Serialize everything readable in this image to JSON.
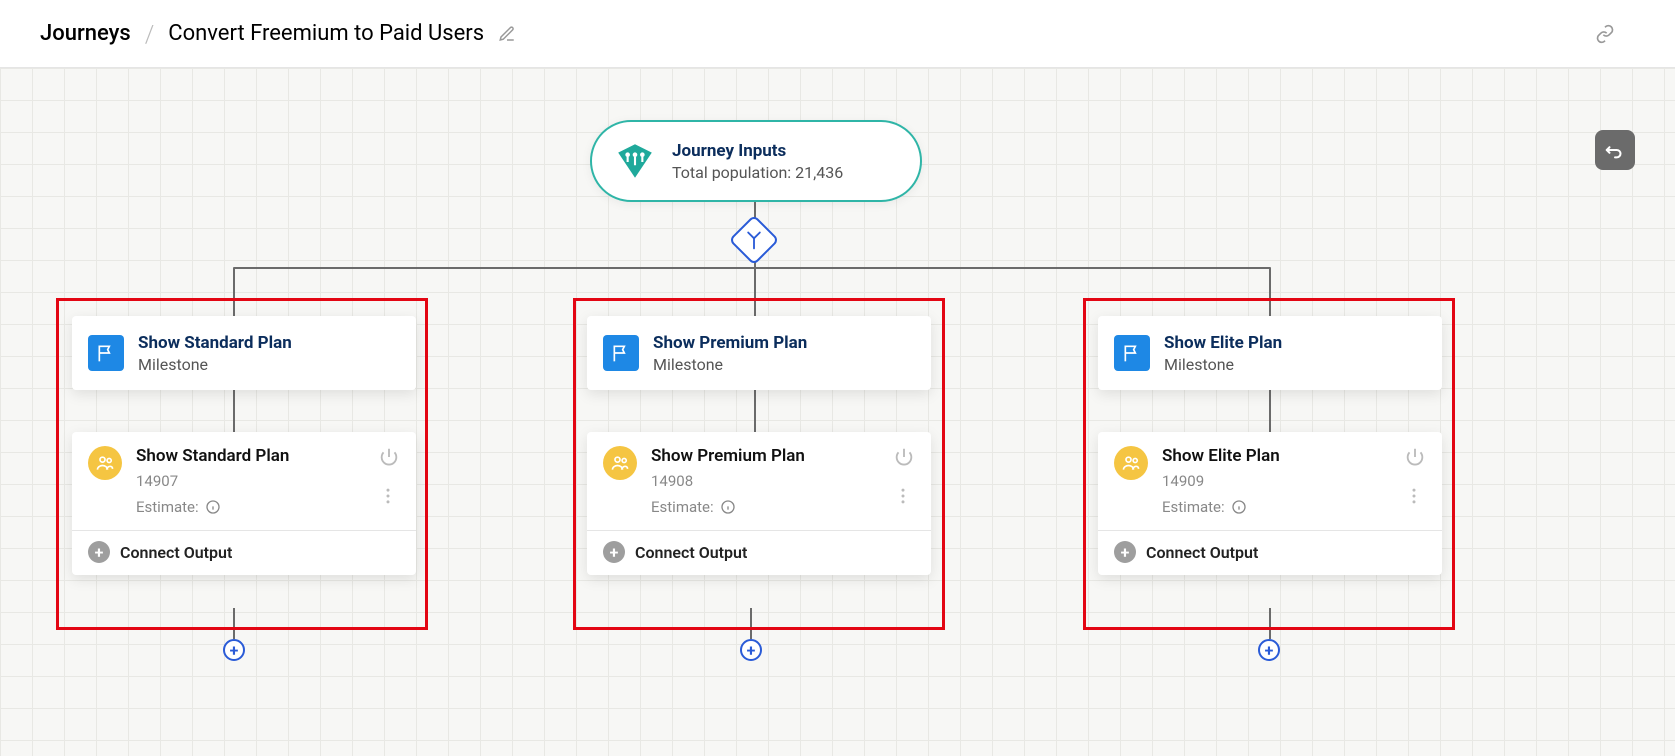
{
  "breadcrumb": {
    "root": "Journeys",
    "current": "Convert Freemium to Paid Users"
  },
  "journey_inputs": {
    "title": "Journey Inputs",
    "subtitle": "Total population: 21,436"
  },
  "milestone_label": "Milestone",
  "estimate_label": "Estimate:",
  "connect_output_label": "Connect Output",
  "branches": [
    {
      "milestone_title": "Show Standard Plan",
      "action_title": "Show Standard Plan",
      "action_id": "14907"
    },
    {
      "milestone_title": "Show Premium Plan",
      "action_title": "Show Premium Plan",
      "action_id": "14908"
    },
    {
      "milestone_title": "Show Elite Plan",
      "action_title": "Show Elite Plan",
      "action_id": "14909"
    }
  ]
}
